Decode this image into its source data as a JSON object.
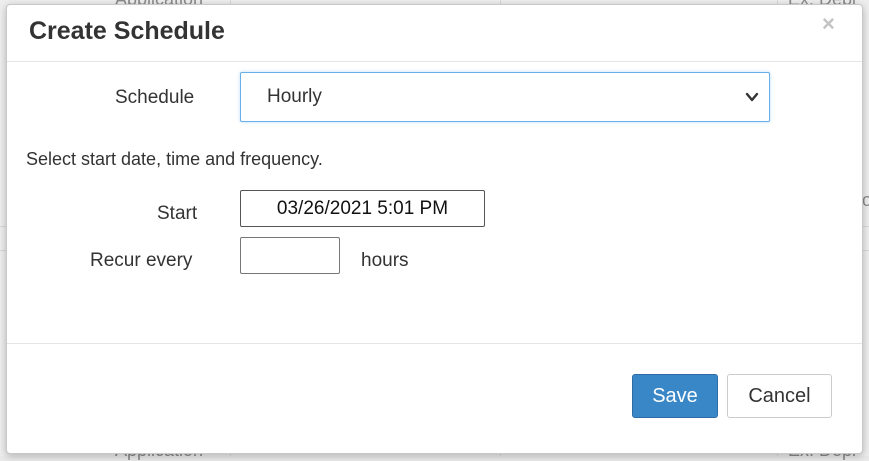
{
  "background": {
    "fragments": [
      "Application",
      "Ex: Depl",
      "ol",
      "Application",
      "Ex: Depl"
    ]
  },
  "dialog": {
    "title": "Create Schedule",
    "close_glyph": "×",
    "schedule_label": "Schedule",
    "schedule_value": "Hourly",
    "help_text": "Select start date, time and frequency.",
    "start_label": "Start",
    "start_value": "03/26/2021 5:01 PM",
    "recur_label": "Recur every",
    "recur_value": "",
    "recur_unit": "hours",
    "save_label": "Save",
    "cancel_label": "Cancel"
  },
  "colors": {
    "primary": "#3a87c8",
    "focus_border": "#66afe9"
  }
}
